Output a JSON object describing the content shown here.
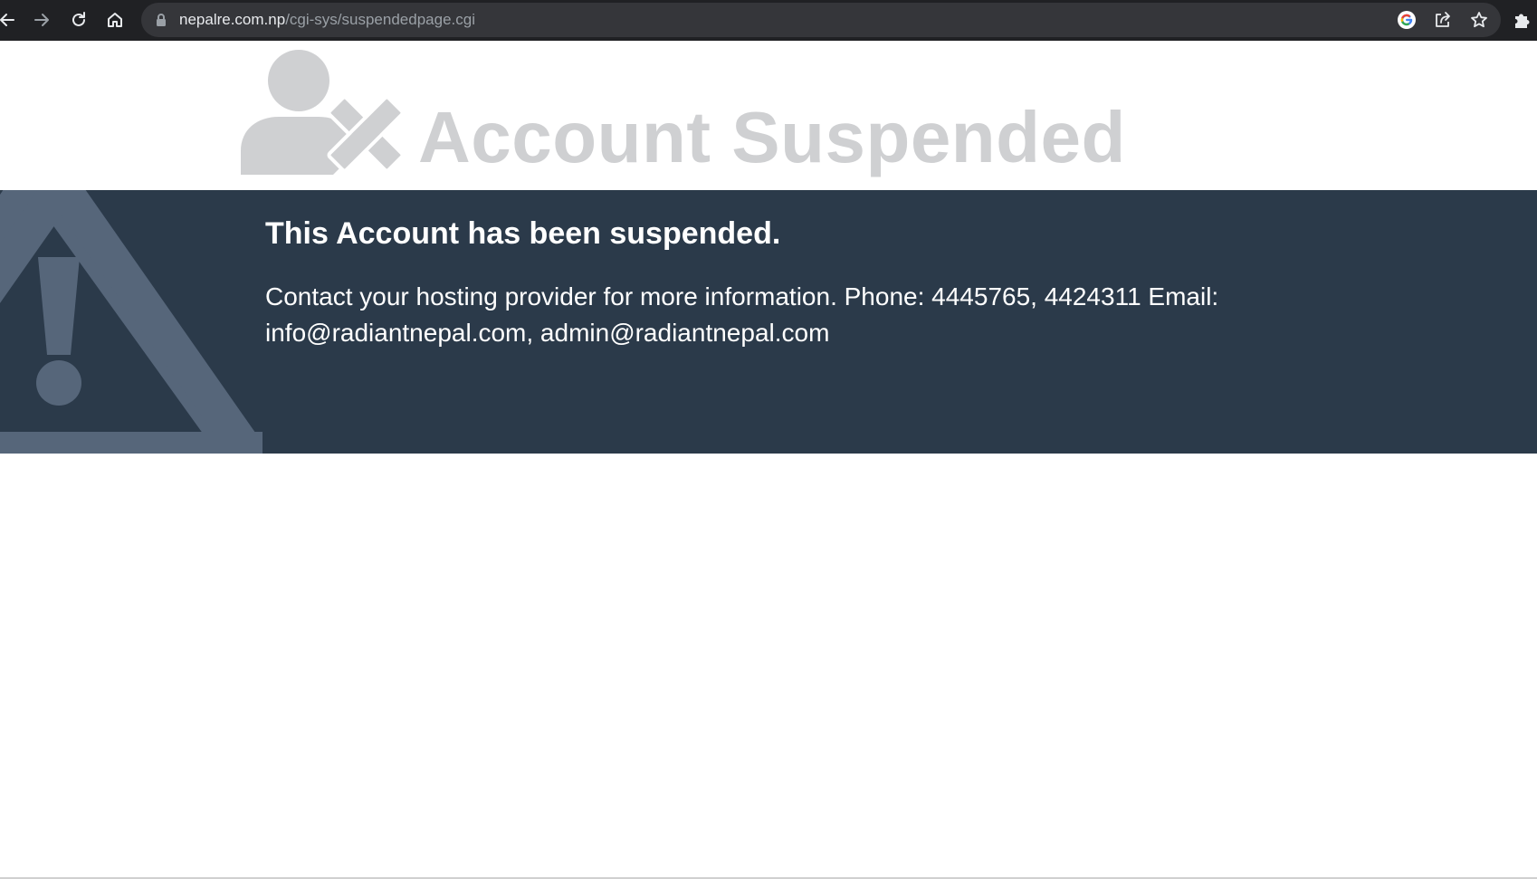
{
  "browser": {
    "url_host": "nepalre.com.np",
    "url_path": "/cgi-sys/suspendedpage.cgi",
    "icons": {
      "back": "back-arrow-icon",
      "forward": "forward-arrow-icon",
      "reload": "reload-icon",
      "home": "home-icon",
      "lock": "lock-icon",
      "google": "google-icon",
      "share": "share-icon",
      "bookmark": "star-icon",
      "extensions": "puzzle-icon"
    }
  },
  "page": {
    "title": "Account Suspended",
    "banner": {
      "heading": "This Account has been suspended.",
      "message": "Contact your hosting provider for more information. Phone: 4445765, 4424311 Email: info@radiantnepal.com, admin@radiantnepal.com"
    }
  },
  "colors": {
    "chrome_bg": "#202124",
    "omnibox_bg": "#35363a",
    "banner_bg": "#2b3a4a",
    "title_gray": "#cfd0d2",
    "icon_gray": "#cfd0d2",
    "warning_gray": "#56667a"
  }
}
